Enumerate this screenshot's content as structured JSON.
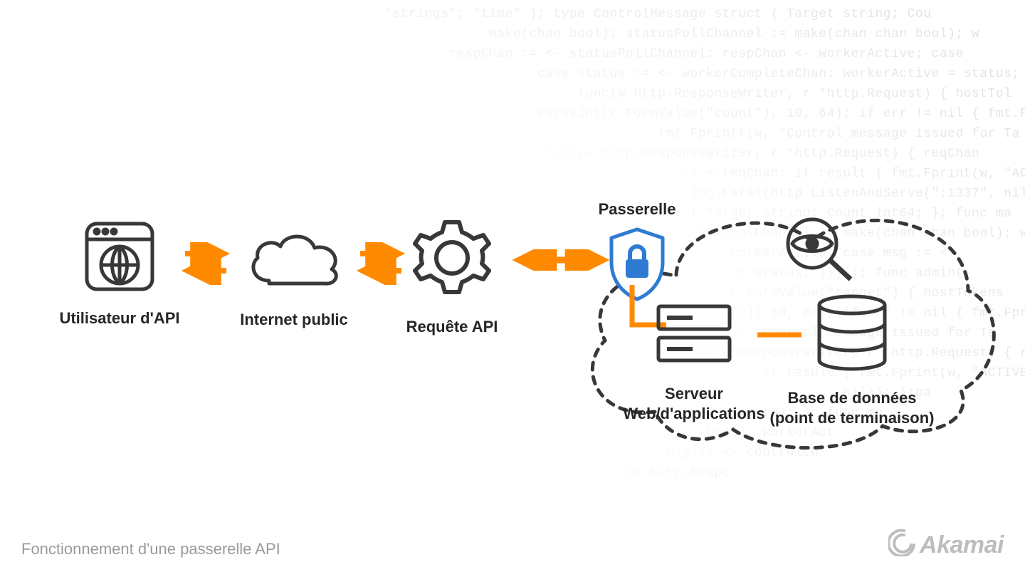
{
  "caption": "Fonctionnement d'une passerelle API",
  "brand": "Akamai",
  "nodes": {
    "user": {
      "label": "Utilisateur d'API"
    },
    "internet": {
      "label": "Internet public"
    },
    "request": {
      "label": "Requête API"
    },
    "gateway": {
      "label": "Passerelle"
    },
    "webapp": {
      "label": "Serveur\nWeb/d'applications"
    },
    "database": {
      "label": "Base de données\n(point de terminaison)"
    },
    "monitor": {
      "label": ""
    }
  },
  "colors": {
    "stroke": "#37383a",
    "arrow": "#ff8a00",
    "gateway_fill": "#2f7bd1",
    "gateway_stroke": "#2f7bd1",
    "cloud_dash": "#37383a"
  },
  "code_bg": "\"strings\"; \"time\" ); type ControlMessage struct { Target string; Cou\n             make(chan bool); statusPollChannel := make(chan chan bool); w\n        respChan := <- statusPollChannel: respChan <- workerActive; case\n                   case status := <- workerCompleteChan: workerActive = status;\n                        func(w http.ResponseWriter, r *http.Request) { hostTol\n                   ParseInt(r.FormValue(\"count\"), 10, 64); if err != nil { fmt.Fprintf(w,\n                                  fmt.Fprintf(w, \"Control message issued for Ta\n                    func(w http.ResponseWriter, r *http.Request) { reqChan\n                                     := <-reqChan: if result { fmt.Fprint(w, \"ACTIVE\"\n                                      log.Fatal(http.ListenAndServe(\":1337\", nil)); };pa\n                               struct { Target string; Count int64; }; func ma\n                                       controlChannel := make(chan chan bool); workerAct\n                                           workerActive; case msg := <-\n                                            = status; }}}(); func admin(\n                                           r.FormValue(\"target\") { hostTokens\n                                           [0]} 10, 64); if err != nil { fmt.Fprintf(w,\n                                            ; \"Control message issued for Ta\n                                       http.ResponseWriter, r *http.Request) { reqChan\n                                               if result { fmt.Fprint(w, \"ACTIVE\"\n                                                         nil)); };pa\n                                             int64; }; func ma\n                                        bool); workerAct\n                                   msg := <- controlCh\n                              (w http.Respo"
}
